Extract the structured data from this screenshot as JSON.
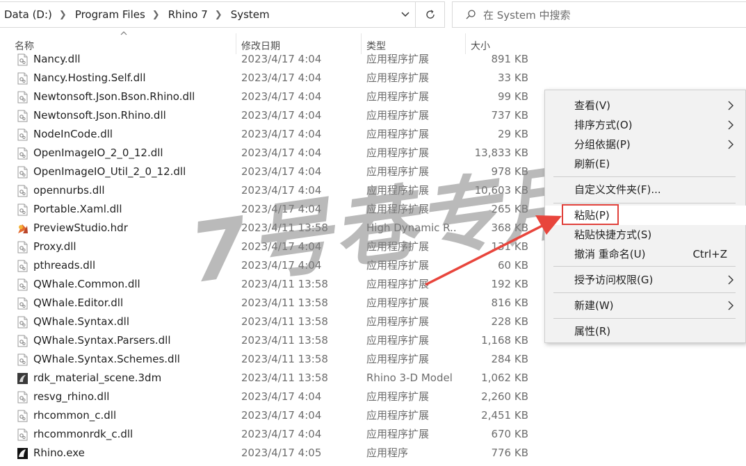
{
  "address": {
    "crumbs": [
      "Data (D:)",
      "Program Files",
      "Rhino 7",
      "System"
    ]
  },
  "search": {
    "placeholder": "在 System 中搜索"
  },
  "columns": {
    "name": "名称",
    "date": "修改日期",
    "type": "类型",
    "size": "大小"
  },
  "files": [
    {
      "name": "Nancy.dll",
      "date": "2023/4/17 4:04",
      "type": "应用程序扩展",
      "size": "891 KB",
      "icon": "dll-file-icon"
    },
    {
      "name": "Nancy.Hosting.Self.dll",
      "date": "2023/4/17 4:04",
      "type": "应用程序扩展",
      "size": "33 KB",
      "icon": "dll-file-icon"
    },
    {
      "name": "Newtonsoft.Json.Bson.Rhino.dll",
      "date": "2023/4/17 4:04",
      "type": "应用程序扩展",
      "size": "99 KB",
      "icon": "dll-file-icon"
    },
    {
      "name": "Newtonsoft.Json.Rhino.dll",
      "date": "2023/4/17 4:04",
      "type": "应用程序扩展",
      "size": "737 KB",
      "icon": "dll-file-icon"
    },
    {
      "name": "NodeInCode.dll",
      "date": "2023/4/17 4:04",
      "type": "应用程序扩展",
      "size": "29 KB",
      "icon": "dll-file-icon"
    },
    {
      "name": "OpenImageIO_2_0_12.dll",
      "date": "2023/4/17 4:04",
      "type": "应用程序扩展",
      "size": "13,833 KB",
      "icon": "dll-file-icon"
    },
    {
      "name": "OpenImageIO_Util_2_0_12.dll",
      "date": "2023/4/17 4:04",
      "type": "应用程序扩展",
      "size": "978 KB",
      "icon": "dll-file-icon"
    },
    {
      "name": "opennurbs.dll",
      "date": "2023/4/17 4:04",
      "type": "应用程序扩展",
      "size": "10,603 KB",
      "icon": "dll-file-icon"
    },
    {
      "name": "Portable.Xaml.dll",
      "date": "2023/4/17 4:04",
      "type": "应用程序扩展",
      "size": "265 KB",
      "icon": "dll-file-icon"
    },
    {
      "name": "PreviewStudio.hdr",
      "date": "2023/4/11 13:58",
      "type": "High Dynamic R...",
      "size": "368 KB",
      "icon": "hdr-file-icon"
    },
    {
      "name": "Proxy.dll",
      "date": "2023/4/17 4:04",
      "type": "应用程序扩展",
      "size": "131 KB",
      "icon": "dll-file-icon"
    },
    {
      "name": "pthreads.dll",
      "date": "2023/4/17 4:04",
      "type": "应用程序扩展",
      "size": "60 KB",
      "icon": "dll-file-icon"
    },
    {
      "name": "QWhale.Common.dll",
      "date": "2023/4/11 13:58",
      "type": "应用程序扩展",
      "size": "192 KB",
      "icon": "dll-file-icon"
    },
    {
      "name": "QWhale.Editor.dll",
      "date": "2023/4/11 13:58",
      "type": "应用程序扩展",
      "size": "816 KB",
      "icon": "dll-file-icon"
    },
    {
      "name": "QWhale.Syntax.dll",
      "date": "2023/4/11 13:58",
      "type": "应用程序扩展",
      "size": "228 KB",
      "icon": "dll-file-icon"
    },
    {
      "name": "QWhale.Syntax.Parsers.dll",
      "date": "2023/4/11 13:58",
      "type": "应用程序扩展",
      "size": "1,168 KB",
      "icon": "dll-file-icon"
    },
    {
      "name": "QWhale.Syntax.Schemes.dll",
      "date": "2023/4/11 13:58",
      "type": "应用程序扩展",
      "size": "284 KB",
      "icon": "dll-file-icon"
    },
    {
      "name": "rdk_material_scene.3dm",
      "date": "2023/4/11 13:58",
      "type": "Rhino 3-D Model",
      "size": "1,062 KB",
      "icon": "3dm-file-icon"
    },
    {
      "name": "resvg_rhino.dll",
      "date": "2023/4/17 4:04",
      "type": "应用程序扩展",
      "size": "2,260 KB",
      "icon": "dll-file-icon"
    },
    {
      "name": "rhcommon_c.dll",
      "date": "2023/4/17 4:04",
      "type": "应用程序扩展",
      "size": "2,451 KB",
      "icon": "dll-file-icon"
    },
    {
      "name": "rhcommonrdk_c.dll",
      "date": "2023/4/17 4:04",
      "type": "应用程序扩展",
      "size": "670 KB",
      "icon": "dll-file-icon"
    },
    {
      "name": "Rhino.exe",
      "date": "2023/4/17 4:05",
      "type": "应用程序",
      "size": "776 KB",
      "icon": "rhino-exe-icon"
    }
  ],
  "watermark": "7号巷专用",
  "menu": {
    "view": "查看(V)",
    "sort": "排序方式(O)",
    "group": "分组依据(P)",
    "refresh": "刷新(E)",
    "customize": "自定义文件夹(F)...",
    "paste": "粘贴(P)",
    "paste_shortcut": "粘贴快捷方式(S)",
    "undo": "撤消 重命名(U)",
    "undo_shortcut": "Ctrl+Z",
    "grant": "授予访问权限(G)",
    "new": "新建(W)",
    "properties": "属性(R)"
  },
  "colors": {
    "highlight": "#e0403a",
    "menu_bg": "#f2f2f2"
  }
}
